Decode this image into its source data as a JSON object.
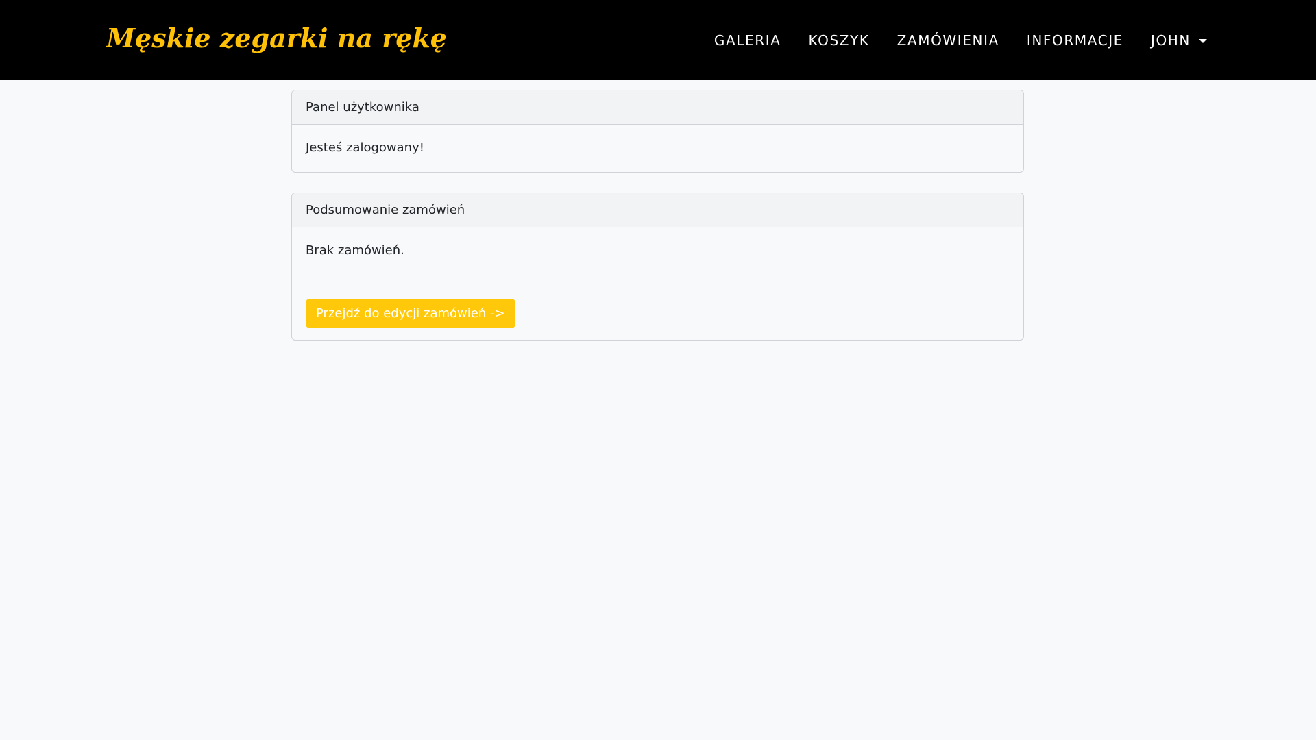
{
  "navbar": {
    "brand": "Męskie zegarki na rękę",
    "links": [
      {
        "label": "GALERIA"
      },
      {
        "label": "KOSZYK"
      },
      {
        "label": "ZAMÓWIENIA"
      },
      {
        "label": "INFORMACJE"
      }
    ],
    "user_menu": {
      "label": "JOHN",
      "icon": "caret-down-icon"
    }
  },
  "cards": {
    "user_panel": {
      "header": "Panel użytkownika",
      "body": "Jesteś zalogowany!"
    },
    "orders_summary": {
      "header": "Podsumowanie zamówień",
      "body": "Brak zamówień.",
      "button_label": "Przejdź do edycji zamówień ->"
    }
  },
  "colors": {
    "navbar_bg": "#000000",
    "brand": "#ffc107",
    "page_bg": "#f8f9fa",
    "button_bg": "#ffc80a"
  }
}
